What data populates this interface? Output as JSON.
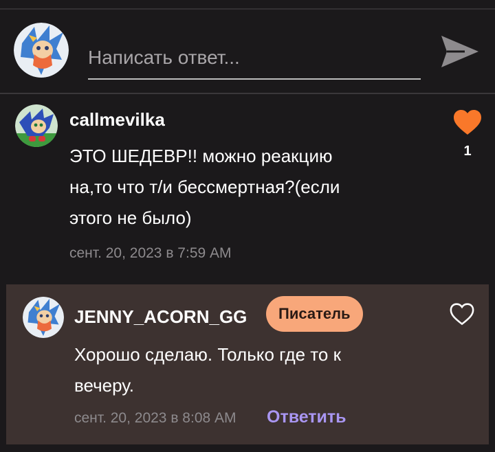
{
  "reply_bar": {
    "avatar": "user-avatar-character-icon",
    "placeholder": "Написать ответ...",
    "send_icon": "send-icon"
  },
  "comment": {
    "avatar": "hedgehog-avatar-icon",
    "username": "callmevilka",
    "text_lines": [
      "ЭТО ШЕДЕВР!! можно реакцию",
      "на,то что т/и бессмертная?(если",
      "этого не было)"
    ],
    "timestamp": "сент. 20, 2023 в 7:59 AM",
    "likes": "1",
    "liked": true,
    "like_color": "#f9782a"
  },
  "reply": {
    "avatar": "user-avatar-character-icon",
    "username": "JENNY_ACORN_GG",
    "badge": "Писатель",
    "badge_color": "#f8a77a",
    "text_lines": [
      "Хорошо сделаю. Только где то к",
      "вечеру."
    ],
    "timestamp": "сент. 20, 2023 в 8:08 AM",
    "reply_label": "Ответить",
    "reply_color": "#a996f2",
    "liked": false
  }
}
